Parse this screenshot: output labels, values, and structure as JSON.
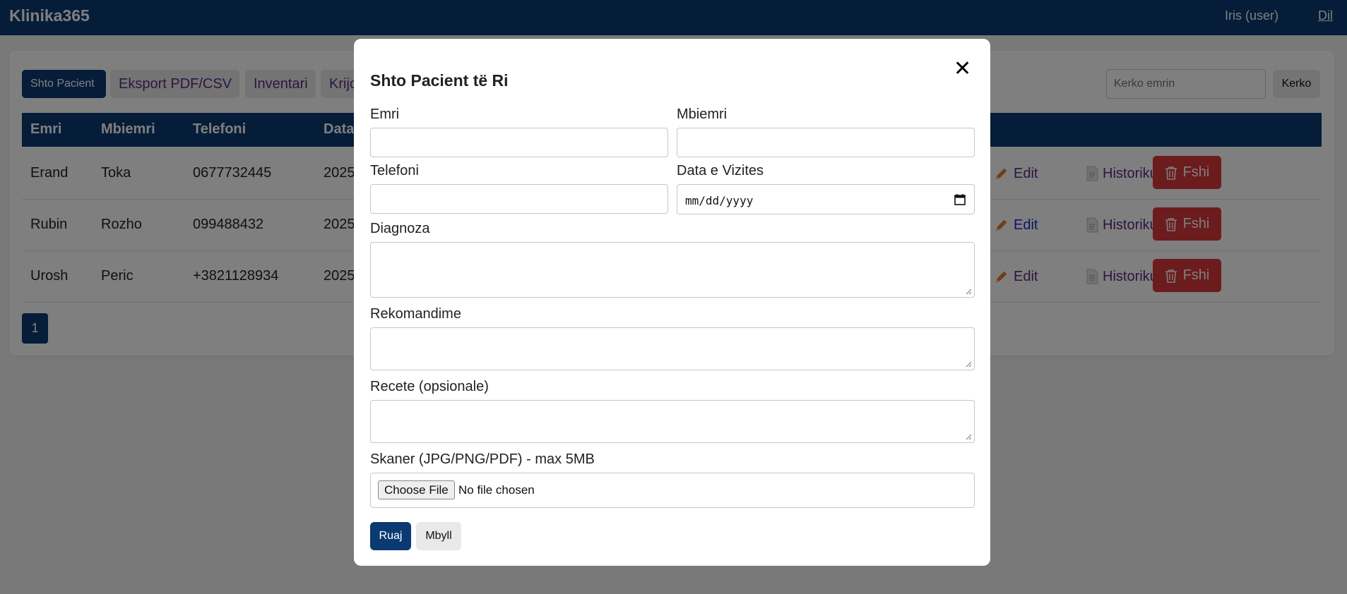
{
  "navbar": {
    "brand": "Klinika365",
    "user": "Iris (user)",
    "logout": "Dil"
  },
  "toolbar": {
    "add_patient": "Shto Pacient",
    "export": "Eksport PDF/CSV",
    "inventory": "Inventari",
    "create_partial": "Krijo",
    "search_placeholder": "Kerko emrin",
    "search_button": "Kerko"
  },
  "table": {
    "headers": [
      "Emri",
      "Mbiemri",
      "Telefoni",
      "Data"
    ],
    "rows": [
      {
        "emri": "Erand",
        "mbiemri": "Toka",
        "telefoni": "0677732445",
        "data": "2025"
      },
      {
        "emri": "Rubin",
        "mbiemri": "Rozho",
        "telefoni": "099488432",
        "data": "2025"
      },
      {
        "emri": "Urosh",
        "mbiemri": "Peric",
        "telefoni": "+3821128934",
        "data": "2025"
      }
    ],
    "actions": {
      "edit": "Edit",
      "history": "Historiku",
      "delete": "Fshi"
    }
  },
  "pagination": {
    "current": "1"
  },
  "modal": {
    "title": "Shto Pacient të Ri",
    "close_symbol": "✕",
    "labels": {
      "emri": "Emri",
      "mbiemri": "Mbiemri",
      "telefoni": "Telefoni",
      "data_vizites": "Data e Vizites",
      "diagnoza": "Diagnoza",
      "rekomandime": "Rekomandime",
      "recete": "Recete (opsionale)",
      "skaner": "Skaner (JPG/PNG/PDF) - max 5MB"
    },
    "date_placeholder": "mm/dd/yyyy",
    "file_button": "Choose File",
    "file_status": "No file chosen",
    "save": "Ruaj",
    "close": "Mbyll"
  },
  "colors": {
    "primary": "#0b3a73",
    "danger": "#d9393a",
    "link": "#5b2c83",
    "overlay": "rgba(0,0,0,0.5)"
  }
}
